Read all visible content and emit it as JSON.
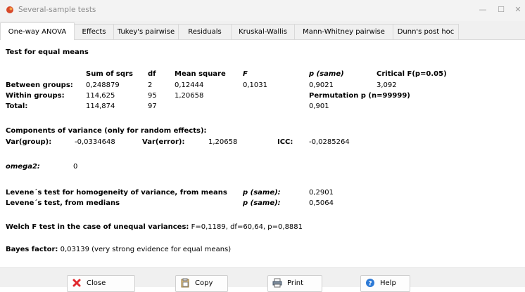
{
  "window": {
    "title": "Several-sample tests"
  },
  "tabs": [
    "One-way ANOVA",
    "Effects",
    "Tukey's pairwise",
    "Residuals",
    "Kruskal-Wallis",
    "Mann-Whitney pairwise",
    "Dunn's post hoc"
  ],
  "anova": {
    "heading": "Test for equal means",
    "headers": {
      "sumsq": "Sum of sqrs",
      "df": "df",
      "meansq": "Mean square",
      "f": "F",
      "p_same": "p (same)",
      "critical": "Critical F(p=0.05)"
    },
    "rows": [
      {
        "label": "Between groups:",
        "sumsq": "0,248879",
        "df": "2",
        "meansq": "0,12444",
        "f": "0,1031",
        "p": "0,9021",
        "crit": "3,092"
      },
      {
        "label": "Within groups:",
        "sumsq": "114,625",
        "df": "95",
        "meansq": "1,20658"
      },
      {
        "label": "Total:",
        "sumsq": "114,874",
        "df": "97",
        "p": "0,901"
      }
    ],
    "permutation_label": "Permutation p (n=99999)"
  },
  "components": {
    "heading": "Components of variance (only for random effects):",
    "var_group_label": "Var(group):",
    "var_group": "-0,0334648",
    "var_error_label": "Var(error):",
    "var_error": "1,20658",
    "icc_label": "ICC:",
    "icc": "-0,0285264"
  },
  "omega": {
    "label": "omega2:",
    "value": "0"
  },
  "levene": {
    "means_label": "Levene´s test for homogeneity of variance, from means",
    "medians_label": "Levene´s test, from medians",
    "p_label": "p (same):",
    "means_p": "0,2901",
    "medians_p": "0,5064"
  },
  "welch": {
    "label": "Welch F test in the case of unequal variances:",
    "values": "F=0,1189, df=60,64, p=0,8881"
  },
  "bayes": {
    "label": "Bayes factor:",
    "value": "0,03139 (very strong evidence for equal means)"
  },
  "buttons": {
    "close": "Close",
    "copy": "Copy",
    "print": "Print",
    "help": "Help"
  }
}
